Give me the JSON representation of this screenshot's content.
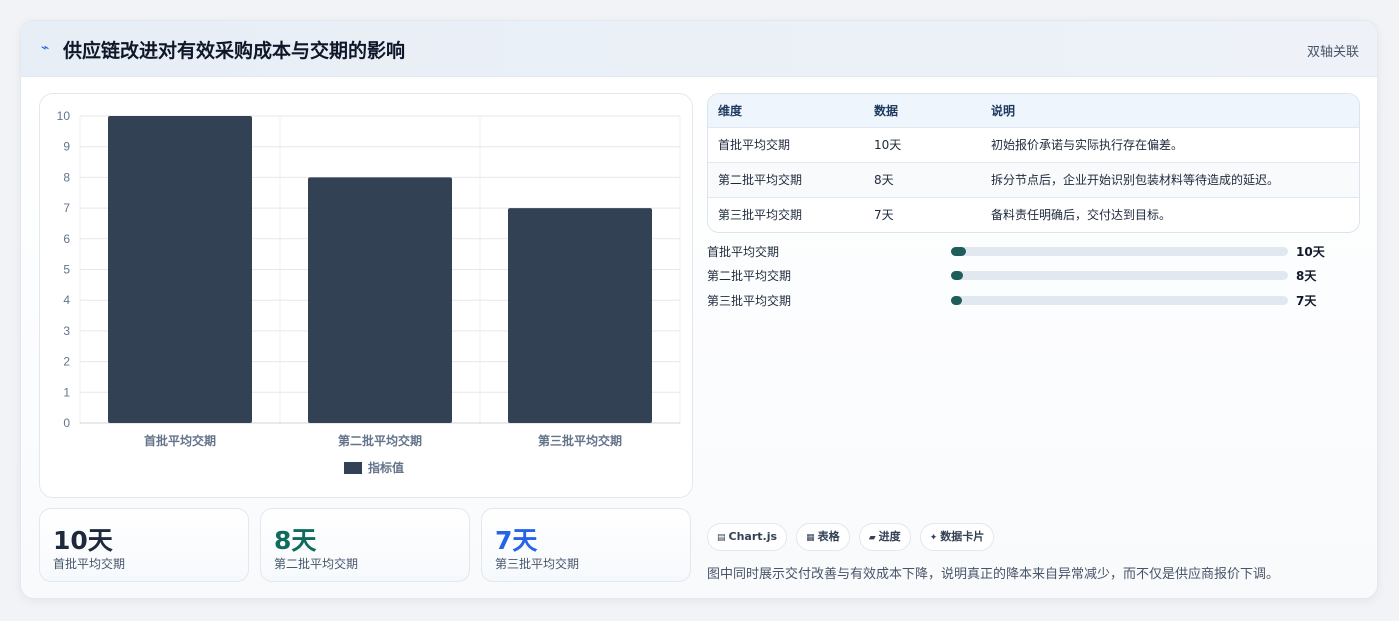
{
  "header": {
    "icon": "lightning-icon",
    "title": "供应链改进对有效采购成本与交期的影响",
    "tag": "双轴关联"
  },
  "chart_data": {
    "type": "bar",
    "categories": [
      "首批平均交期",
      "第二批平均交期",
      "第三批平均交期"
    ],
    "series": [
      {
        "name": "指标值",
        "values": [
          10,
          8,
          7
        ],
        "color": "#334155"
      }
    ],
    "ylim": [
      0,
      10
    ],
    "yticks": [
      0,
      1,
      2,
      3,
      4,
      5,
      6,
      7,
      8,
      9,
      10
    ],
    "xlabel": "",
    "ylabel": "",
    "grid": true,
    "legend": "bottom"
  },
  "kpis": [
    {
      "value": "10天",
      "label": "首批平均交期",
      "color": "#1e293b"
    },
    {
      "value": "8天",
      "label": "第二批平均交期",
      "color": "#0f6b5c"
    },
    {
      "value": "7天",
      "label": "第三批平均交期",
      "color": "#2563eb"
    }
  ],
  "table": {
    "headers": [
      "维度",
      "数据",
      "说明"
    ],
    "rows": [
      [
        "首批平均交期",
        "10天",
        "初始报价承诺与实际执行存在偏差。"
      ],
      [
        "第二批平均交期",
        "8天",
        "拆分节点后，企业开始识别包装材料等待造成的延迟。"
      ],
      [
        "第三批平均交期",
        "7天",
        "备料责任明确后，交付达到目标。"
      ]
    ]
  },
  "progress": [
    {
      "label": "首批平均交期",
      "value": "10天",
      "fraction": 0.045
    },
    {
      "label": "第二批平均交期",
      "value": "8天",
      "fraction": 0.036
    },
    {
      "label": "第三批平均交期",
      "value": "7天",
      "fraction": 0.032
    }
  ],
  "chips": [
    {
      "icon": "chart-icon",
      "glyph": "▤",
      "label": "Chart.js"
    },
    {
      "icon": "table-icon",
      "glyph": "▦",
      "label": "表格"
    },
    {
      "icon": "progress-icon",
      "glyph": "▰",
      "label": "进度"
    },
    {
      "icon": "sparkle-icon",
      "glyph": "✦",
      "label": "数据卡片"
    }
  ],
  "footnote": "图中同时展示交付改善与有效成本下降，说明真正的降本来自异常减少，而不仅是供应商报价下调。"
}
